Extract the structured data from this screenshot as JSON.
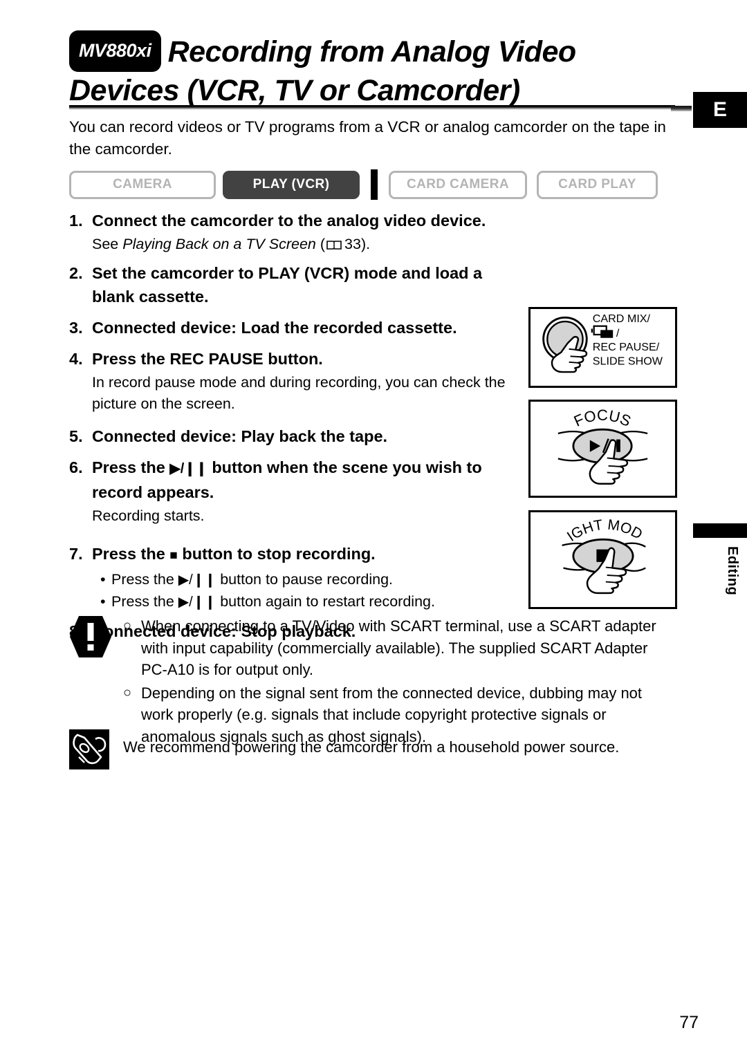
{
  "header": {
    "model_badge": "MV880xi",
    "title_line1": "Recording from Analog Video",
    "title_line2": "Devices (VCR, TV or Camcorder)",
    "language_tab": "E"
  },
  "intro": "You can record videos or TV programs from a VCR or analog camcorder on the tape in the camcorder.",
  "modes": [
    {
      "label": "CAMERA",
      "active": false
    },
    {
      "label": "PLAY (VCR)",
      "active": true
    },
    {
      "label": "CARD CAMERA",
      "active": false
    },
    {
      "label": "CARD PLAY",
      "active": false
    }
  ],
  "steps": {
    "s1_num": "1.",
    "s1_text": "Connect the camcorder to the analog video device.",
    "s1_sub_pre": "See ",
    "s1_sub_italic": "Playing Back on a TV Screen",
    "s1_sub_open": " (",
    "s1_sub_page": "33",
    "s1_sub_close": ").",
    "s2_num": "2.",
    "s2_text": "Set the camcorder to PLAY (VCR) mode and load a blank cassette.",
    "s3_num": "3.",
    "s3_text": "Connected device: Load the recorded cassette.",
    "s4_num": "4.",
    "s4_text": "Press the REC PAUSE button.",
    "s4_sub": "In record pause mode and during recording, you can check the picture on the screen.",
    "s5_num": "5.",
    "s5_text": "Connected device: Play back the tape.",
    "s6_num": "6.",
    "s6_text_pre": "Press the ",
    "s6_glyph": "▶/❙❙",
    "s6_text_post": " button when the scene you wish to record appears.",
    "s6_sub": "Recording starts.",
    "s7_num": "7.",
    "s7_text_pre": "Press the ",
    "s7_glyph": "■",
    "s7_text_post": " button to stop recording.",
    "s7_bullet1_pre": "Press the ",
    "s7_bullet1_glyph": "▶/❙❙",
    "s7_bullet1_post": " button to pause recording.",
    "s7_bullet2_pre": "Press the ",
    "s7_bullet2_glyph": "▶/❙❙",
    "s7_bullet2_post": " button again to restart recording.",
    "s8_num": "8.",
    "s8_text": "Connected device: Stop playback."
  },
  "illustrations": {
    "rec_pause": {
      "label_line1": "CARD MIX/",
      "label_line2": "/",
      "label_line3": "REC PAUSE/",
      "label_line4": "SLIDE SHOW"
    },
    "play_pause": {
      "label": "FOCUS",
      "button_glyph": "▶/❙❙"
    },
    "stop": {
      "label": "NIGHT MODE",
      "button_glyph": "■"
    }
  },
  "side_tab": {
    "label": "Editing"
  },
  "notes": {
    "caution_items": [
      "When connecting to a TV/Video with SCART terminal, use a SCART adapter with input capability (commercially available). The supplied SCART Adapter PC-A10 is for output only.",
      "Depending on the signal sent from the connected device, dubbing may not work properly (e.g. signals that include copyright protective signals or anomalous signals such as ghost signals)."
    ],
    "caution_marker": "○",
    "memo_text": "We recommend powering the camcorder from a household power source."
  },
  "footer": {
    "page_number": "77"
  },
  "colors": {
    "ink": "#000000",
    "inactive_badge": "#b4b4b4",
    "active_badge_bg": "#424242",
    "button_gray": "#d4d4d4"
  }
}
